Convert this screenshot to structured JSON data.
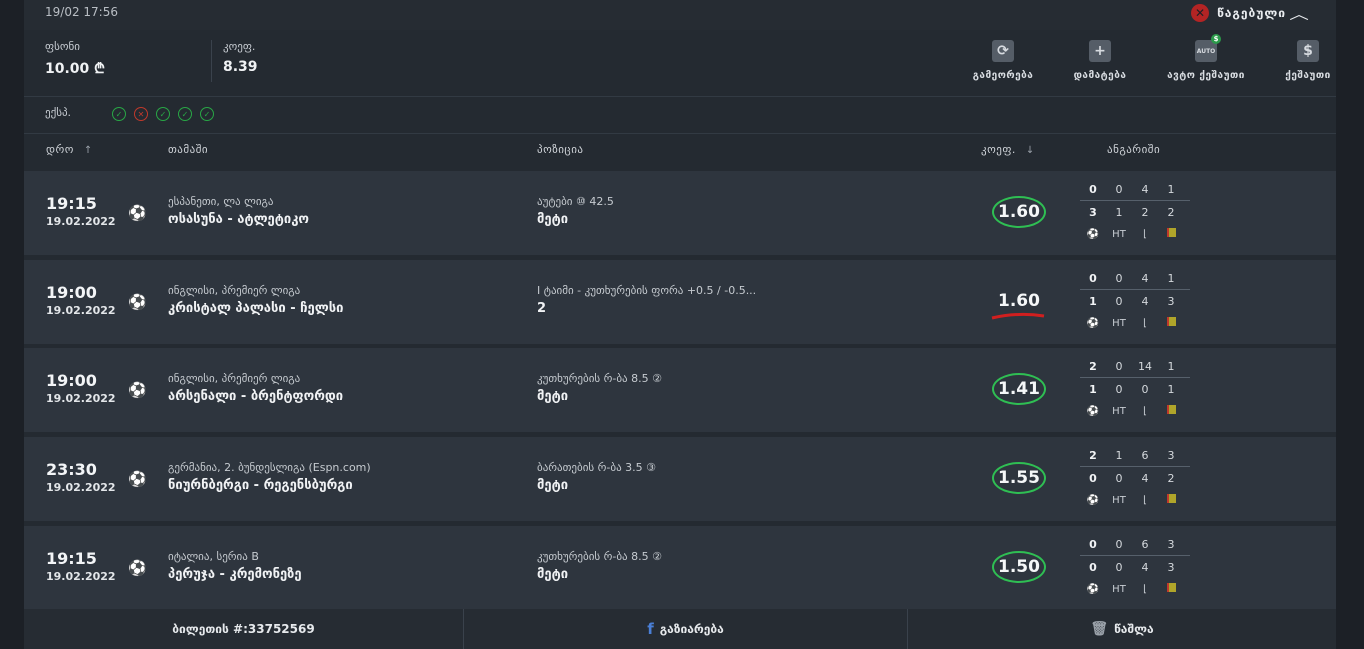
{
  "header": {
    "datetime": "19/02 17:56",
    "status_label": "წაგებული",
    "status_icon": "x-circle-icon",
    "collapse_icon": "chevron-up-icon"
  },
  "summary": {
    "stake_label": "ფსონი",
    "stake_value": "10.00 ₾",
    "odds_label": "კოეფ.",
    "odds_value": "8.39"
  },
  "actions": [
    {
      "label": "გამეორება",
      "icon": "repeat-icon",
      "glyph": "⟳"
    },
    {
      "label": "დამატება",
      "icon": "plus-icon",
      "glyph": "+"
    },
    {
      "label": "ავტო ქეშაუთი",
      "icon": "auto-cashout-icon",
      "glyph": "AUTO"
    },
    {
      "label": "ქეშაუთი",
      "icon": "dollar-icon",
      "glyph": "$"
    }
  ],
  "express": {
    "label": "ექსპ.",
    "results": [
      "ok",
      "no",
      "ok",
      "ok",
      "ok"
    ]
  },
  "columns": {
    "time": "დრო",
    "game": "თამაში",
    "position": "პოზიცია",
    "odds": "კოეფ.",
    "report": "ანგარიში"
  },
  "rows": [
    {
      "time": "19:15",
      "date": "19.02.2022",
      "league": "ესპანეთი, ლა ლიგა",
      "match": "ოსასუნა - ატლეტიკო",
      "market": "აუტები ⑩ 42.5",
      "pick": "მეტი",
      "odds": "1.60",
      "won": true,
      "score_top": [
        "0",
        "0",
        "4",
        "1"
      ],
      "score_bottom": [
        "3",
        "1",
        "2",
        "2"
      ],
      "ht": "HT"
    },
    {
      "time": "19:00",
      "date": "19.02.2022",
      "league": "ინგლისი, პრემიერ ლიგა",
      "match": "კრისტალ პალასი - ჩელსი",
      "market": "I ტაიმი - კუთხურების ფორა +0.5 / -0.5...",
      "pick": "2",
      "odds": "1.60",
      "won": false,
      "score_top": [
        "0",
        "0",
        "4",
        "1"
      ],
      "score_bottom": [
        "1",
        "0",
        "4",
        "3"
      ],
      "ht": "HT"
    },
    {
      "time": "19:00",
      "date": "19.02.2022",
      "league": "ინგლისი, პრემიერ ლიგა",
      "match": "არსენალი - ბრენტფორდი",
      "market": "კუთხურების რ-ბა 8.5 ②",
      "pick": "მეტი",
      "odds": "1.41",
      "won": true,
      "score_top": [
        "2",
        "0",
        "14",
        "1"
      ],
      "score_bottom": [
        "1",
        "0",
        "0",
        "1"
      ],
      "ht": "HT"
    },
    {
      "time": "23:30",
      "date": "19.02.2022",
      "league": "გერმანია, 2. ბუნდესლიგა (Espn.com)",
      "match": "ნიურნბერგი - რეგენსბურგი",
      "market": "ბარათების რ-ბა 3.5 ③",
      "pick": "მეტი",
      "odds": "1.55",
      "won": true,
      "score_top": [
        "2",
        "1",
        "6",
        "3"
      ],
      "score_bottom": [
        "0",
        "0",
        "4",
        "2"
      ],
      "ht": "HT"
    },
    {
      "time": "19:15",
      "date": "19.02.2022",
      "league": "იტალია, სერია B",
      "match": "პერუჯა - კრემონეზე",
      "market": "კუთხურების რ-ბა 8.5 ②",
      "pick": "მეტი",
      "odds": "1.50",
      "won": true,
      "score_top": [
        "0",
        "0",
        "6",
        "3"
      ],
      "score_bottom": [
        "0",
        "0",
        "4",
        "3"
      ],
      "ht": "HT"
    }
  ],
  "footer": {
    "ticket": "ბილეთის #:33752569",
    "share_label": "გაზიარება",
    "delete_label": "წაშლა"
  }
}
